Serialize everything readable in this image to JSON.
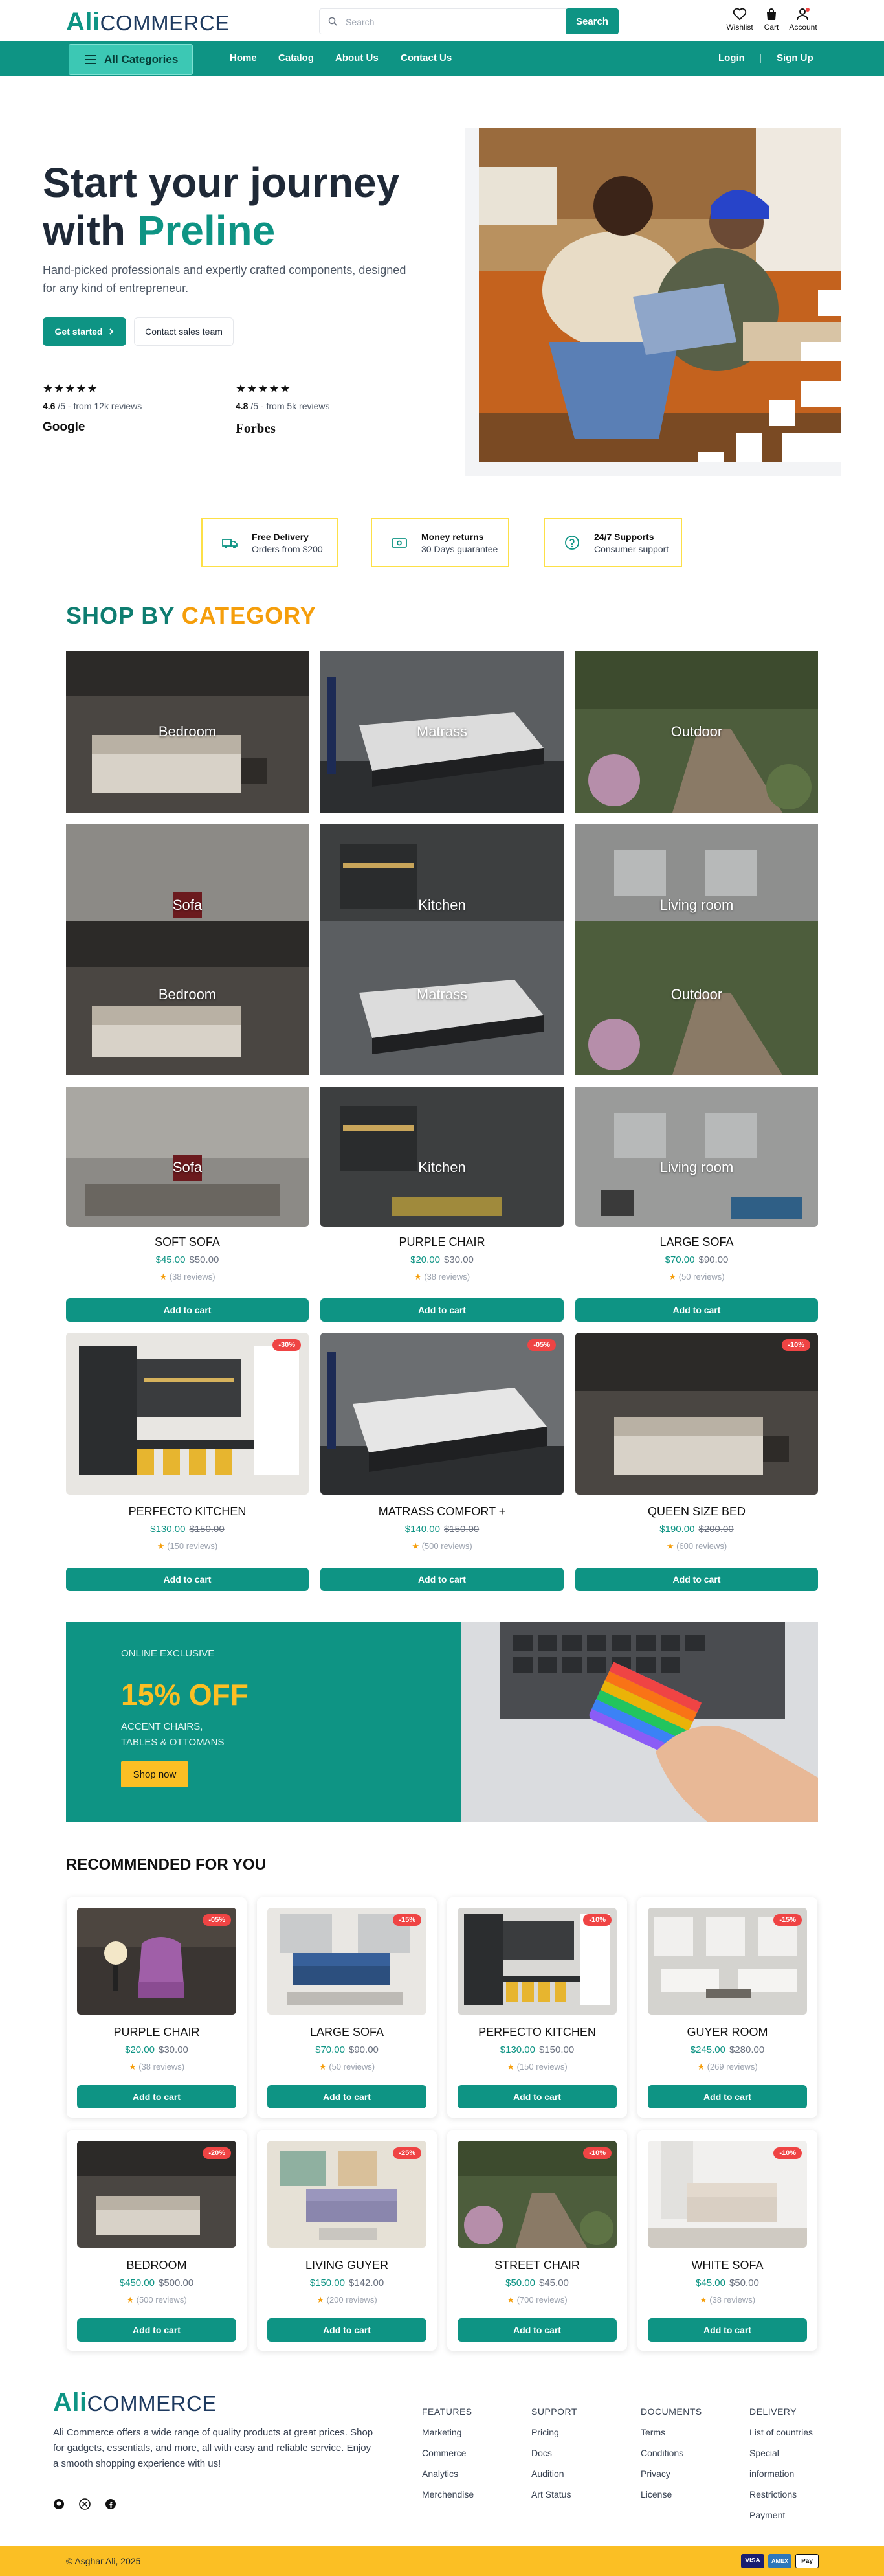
{
  "header": {
    "logo_bold": "Ali",
    "logo_rest": "COMMERCE",
    "search_placeholder": "Search",
    "search_button": "Search",
    "icons": [
      {
        "label": "Wishlist",
        "icon": "heart-icon"
      },
      {
        "label": "Cart",
        "icon": "bag-icon"
      },
      {
        "label": "Account",
        "icon": "user-icon"
      }
    ]
  },
  "nav": {
    "all_categories": "All Categories",
    "links": [
      "Home",
      "Catalog",
      "About Us",
      "Contact Us"
    ],
    "login": "Login",
    "separator": "|",
    "signup": "Sign Up"
  },
  "hero": {
    "title_line1": "Start your journey",
    "title_with": "with",
    "title_accent": "Preline",
    "subtitle": "Hand-picked professionals and expertly crafted components, designed for any kind of entrepreneur.",
    "primary_button": "Get started",
    "secondary_button": "Contact sales team",
    "ratings": [
      {
        "stars": "★★★★★",
        "score": "4.6",
        "text": " /5 - from 12k reviews",
        "brand": "Google"
      },
      {
        "stars": "★★★★★",
        "score": "4.8",
        "text": " /5 - from 5k reviews",
        "brand": "Forbes"
      }
    ]
  },
  "features": [
    {
      "title": "Free Delivery",
      "subtitle": "Orders from $200",
      "icon": "truck-icon"
    },
    {
      "title": "Money returns",
      "subtitle": "30 Days guarantee",
      "icon": "money-icon"
    },
    {
      "title": "24/7 Supports",
      "subtitle": "Consumer support",
      "icon": "support-icon"
    }
  ],
  "category_section": {
    "title_a": "SHOP BY",
    "title_b": "CATEGORY",
    "tiles": [
      "Bedroom",
      "Matrass",
      "Outdoor",
      "Sofa",
      "Kitchen",
      "Living room",
      "Bedroom",
      "Matrass",
      "Outdoor",
      "Sofa",
      "Kitchen",
      "Living room"
    ]
  },
  "products_a": [
    {
      "name": "SOFT SOFA",
      "price": "$45.00",
      "old": "$50.00",
      "reviews": "(38 reviews)"
    },
    {
      "name": "PURPLE CHAIR",
      "price": "$20.00",
      "old": "$30.00",
      "reviews": "(38 reviews)"
    },
    {
      "name": "LARGE SOFA",
      "price": "$70.00",
      "old": "$90.00",
      "reviews": "(50 reviews)"
    }
  ],
  "products_b": [
    {
      "name": "PERFECTO KITCHEN",
      "price": "$130.00",
      "old": "$150.00",
      "reviews": "(150 reviews)",
      "discount": "-30%"
    },
    {
      "name": "MATRASS COMFORT +",
      "price": "$140.00",
      "old": "$150.00",
      "reviews": "(500 reviews)",
      "discount": "-05%"
    },
    {
      "name": "QUEEN SIZE BED",
      "price": "$190.00",
      "old": "$200.00",
      "reviews": "(600 reviews)",
      "discount": "-10%"
    }
  ],
  "add_to_cart": "Add to cart",
  "promo": {
    "eyebrow": "ONLINE EXCLUSIVE",
    "headline": "15% OFF",
    "line1": "ACCENT CHAIRS,",
    "line2": "TABLES & OTTOMANS",
    "button": "Shop now"
  },
  "recommended": {
    "title": "RECOMMENDED FOR YOU",
    "items": [
      {
        "name": "PURPLE CHAIR",
        "price": "$20.00",
        "old": "$30.00",
        "reviews": "(38 reviews)",
        "discount": "-05%"
      },
      {
        "name": "LARGE SOFA",
        "price": "$70.00",
        "old": "$90.00",
        "reviews": "(50 reviews)",
        "discount": "-15%"
      },
      {
        "name": "PERFECTO KITCHEN",
        "price": "$130.00",
        "old": "$150.00",
        "reviews": "(150 reviews)",
        "discount": "-10%"
      },
      {
        "name": "GUYER ROOM",
        "price": "$245.00",
        "old": "$280.00",
        "reviews": "(269 reviews)",
        "discount": "-15%"
      },
      {
        "name": "BEDROOM",
        "price": "$450.00",
        "old": "$500.00",
        "reviews": "(500 reviews)",
        "discount": "-20%"
      },
      {
        "name": "LIVING GUYER",
        "price": "$150.00",
        "old": "$142.00",
        "reviews": "(200 reviews)",
        "discount": "-25%"
      },
      {
        "name": "STREET CHAIR",
        "price": "$50.00",
        "old": "$45.00",
        "reviews": "(700 reviews)",
        "discount": "-10%"
      },
      {
        "name": "WHITE SOFA",
        "price": "$45.00",
        "old": "$50.00",
        "reviews": "(38 reviews)",
        "discount": "-10%"
      }
    ]
  },
  "footer": {
    "about": "Ali Commerce offers a wide range of quality products at great prices. Shop for gadgets, essentials, and more, all with easy and reliable service. Enjoy a smooth shopping experience with us!",
    "social": [
      "github-icon",
      "x-icon",
      "facebook-icon"
    ],
    "columns": [
      {
        "title": "FEATURES",
        "links": [
          "Marketing",
          "Commerce",
          "Analytics",
          "Merchendise"
        ]
      },
      {
        "title": "SUPPORT",
        "links": [
          "Pricing",
          "Docs",
          "Audition",
          "Art Status"
        ]
      },
      {
        "title": "DOCUMENTS",
        "links": [
          "Terms",
          "Conditions",
          "Privacy",
          "License"
        ]
      },
      {
        "title": "DELIVERY",
        "links": [
          "List of countries",
          "Special",
          "information",
          "Restrictions",
          "Payment"
        ]
      }
    ],
    "copyright": "© Asghar Ali, 2025",
    "payments": [
      "VISA",
      "AMEX",
      "Pay"
    ]
  },
  "colors": {
    "brand": "#0e9484",
    "accent": "#f59e0b",
    "sale": "#ef4444",
    "footer_bar": "#fbbf24"
  }
}
